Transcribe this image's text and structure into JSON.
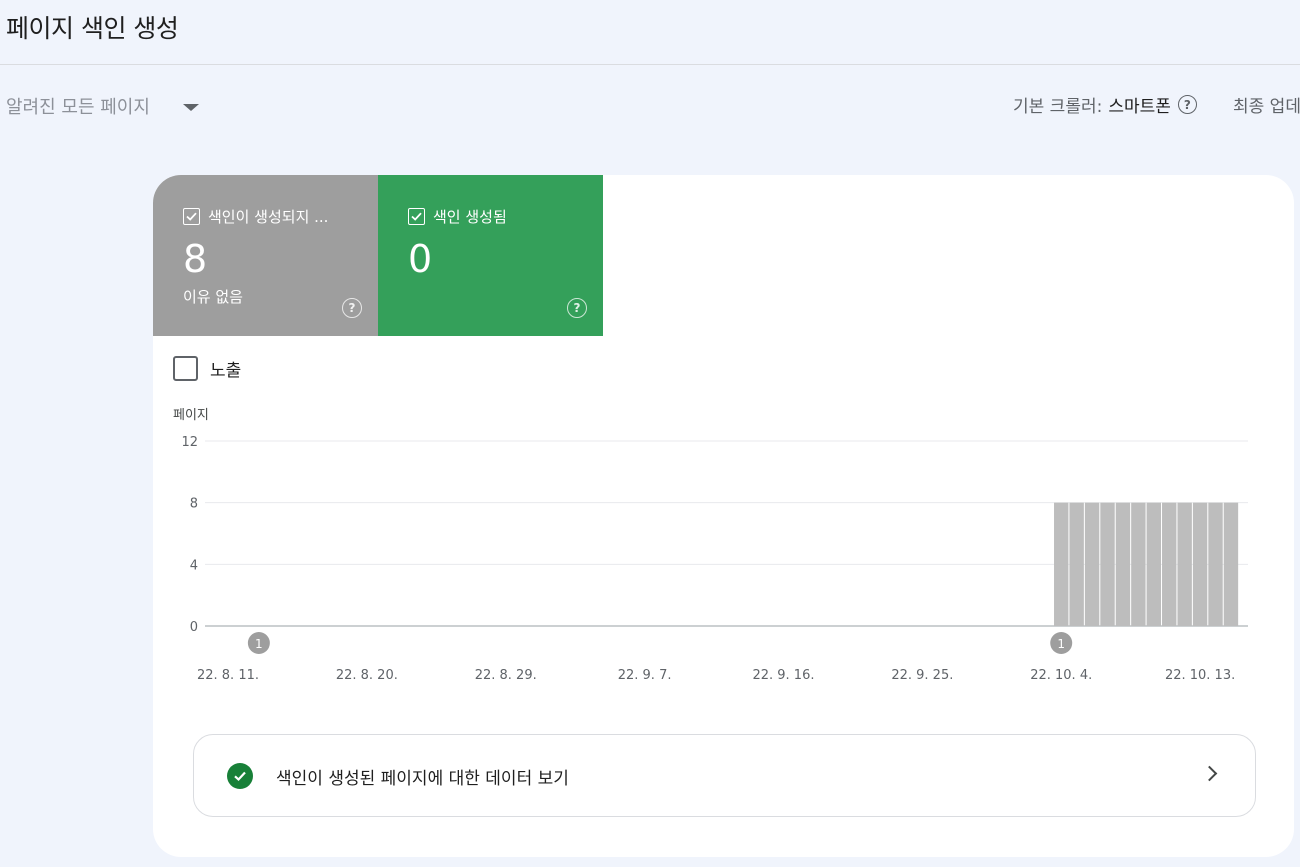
{
  "header": {
    "title": "페이지 색인 생성"
  },
  "filter": {
    "pages_selected": "알려진 모든 페이지",
    "crawler_label": "기본 크롤러:",
    "crawler_value": "스마트폰",
    "last_update_label": "최종 업데"
  },
  "tiles": {
    "not_indexed": {
      "label": "색인이 생성되지 ...",
      "count": "8",
      "sub": "이유 없음",
      "color": "#9e9e9e",
      "checked": true
    },
    "indexed": {
      "label": "색인 생성됨",
      "count": "0",
      "color": "#34a05a",
      "checked": true
    }
  },
  "impressions": {
    "label": "노출",
    "checked": false
  },
  "chart_data": {
    "type": "bar",
    "ylabel": "페이지",
    "ylim": [
      0,
      12
    ],
    "yticks": [
      "12",
      "8",
      "4",
      "0"
    ],
    "xticks": [
      "22. 8. 11.",
      "22. 8. 20.",
      "22. 8. 29.",
      "22. 9. 7.",
      "22. 9. 16.",
      "22. 9. 25.",
      "22. 10. 4.",
      "22. 10. 13."
    ],
    "series": [
      {
        "color": "#bdbdbd",
        "x": [
          "22. 10. 4.",
          "22. 10. 5.",
          "22. 10. 6.",
          "22. 10. 7.",
          "22. 10. 8.",
          "22. 10. 9.",
          "22. 10. 10.",
          "22. 10. 11.",
          "22. 10. 12.",
          "22. 10. 13.",
          "22. 10. 14.",
          "22. 10. 15."
        ],
        "values": [
          8,
          8,
          8,
          8,
          8,
          8,
          8,
          8,
          8,
          8,
          8,
          8
        ]
      }
    ],
    "annotations": [
      {
        "date": "22. 8. 13.",
        "label": "1"
      },
      {
        "date": "22. 10. 4.",
        "label": "1"
      }
    ],
    "grid": true
  },
  "view_data": {
    "label": "색인이 생성된 페이지에 대한 데이터 보기"
  }
}
